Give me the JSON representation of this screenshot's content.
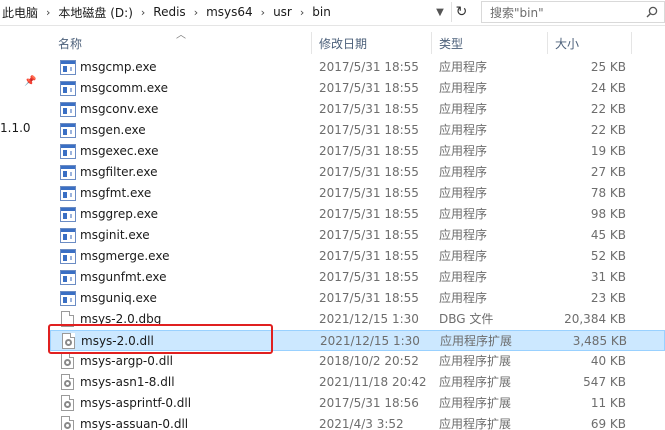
{
  "address": {
    "breadcrumbs": [
      "此电脑",
      "本地磁盘 (D:)",
      "Redis",
      "msys64",
      "usr",
      "bin"
    ],
    "search_placeholder": "搜索\"bin\""
  },
  "left_pane": {
    "version_text": "1.1.0"
  },
  "columns": {
    "name": "名称",
    "date": "修改日期",
    "type": "类型",
    "size": "大小"
  },
  "files": [
    {
      "name": "msgcmp.exe",
      "date": "2017/5/31 18:55",
      "type": "应用程序",
      "size": "25 KB",
      "icon": "exe"
    },
    {
      "name": "msgcomm.exe",
      "date": "2017/5/31 18:55",
      "type": "应用程序",
      "size": "24 KB",
      "icon": "exe"
    },
    {
      "name": "msgconv.exe",
      "date": "2017/5/31 18:55",
      "type": "应用程序",
      "size": "22 KB",
      "icon": "exe"
    },
    {
      "name": "msgen.exe",
      "date": "2017/5/31 18:55",
      "type": "应用程序",
      "size": "22 KB",
      "icon": "exe"
    },
    {
      "name": "msgexec.exe",
      "date": "2017/5/31 18:55",
      "type": "应用程序",
      "size": "19 KB",
      "icon": "exe"
    },
    {
      "name": "msgfilter.exe",
      "date": "2017/5/31 18:55",
      "type": "应用程序",
      "size": "27 KB",
      "icon": "exe"
    },
    {
      "name": "msgfmt.exe",
      "date": "2017/5/31 18:55",
      "type": "应用程序",
      "size": "78 KB",
      "icon": "exe"
    },
    {
      "name": "msggrep.exe",
      "date": "2017/5/31 18:55",
      "type": "应用程序",
      "size": "98 KB",
      "icon": "exe"
    },
    {
      "name": "msginit.exe",
      "date": "2017/5/31 18:55",
      "type": "应用程序",
      "size": "45 KB",
      "icon": "exe"
    },
    {
      "name": "msgmerge.exe",
      "date": "2017/5/31 18:55",
      "type": "应用程序",
      "size": "52 KB",
      "icon": "exe"
    },
    {
      "name": "msgunfmt.exe",
      "date": "2017/5/31 18:55",
      "type": "应用程序",
      "size": "31 KB",
      "icon": "exe"
    },
    {
      "name": "msguniq.exe",
      "date": "2017/5/31 18:55",
      "type": "应用程序",
      "size": "23 KB",
      "icon": "exe"
    },
    {
      "name": "msys-2.0.dbg",
      "date": "2021/12/15 1:30",
      "type": "DBG 文件",
      "size": "20,384 KB",
      "icon": "file"
    },
    {
      "name": "msys-2.0.dll",
      "date": "2021/12/15 1:30",
      "type": "应用程序扩展",
      "size": "3,485 KB",
      "icon": "dll",
      "selected": true
    },
    {
      "name": "msys-argp-0.dll",
      "date": "2018/10/2 20:52",
      "type": "应用程序扩展",
      "size": "40 KB",
      "icon": "dll"
    },
    {
      "name": "msys-asn1-8.dll",
      "date": "2021/11/18 20:42",
      "type": "应用程序扩展",
      "size": "547 KB",
      "icon": "dll"
    },
    {
      "name": "msys-asprintf-0.dll",
      "date": "2017/5/31 18:56",
      "type": "应用程序扩展",
      "size": "11 KB",
      "icon": "dll"
    },
    {
      "name": "msys-assuan-0.dll",
      "date": "2021/4/3 3:52",
      "type": "应用程序扩展",
      "size": "69 KB",
      "icon": "dll"
    }
  ],
  "colors": {
    "selected_bg": "#cce8ff",
    "highlight_border": "#e02020",
    "header_text": "#4c607a"
  }
}
